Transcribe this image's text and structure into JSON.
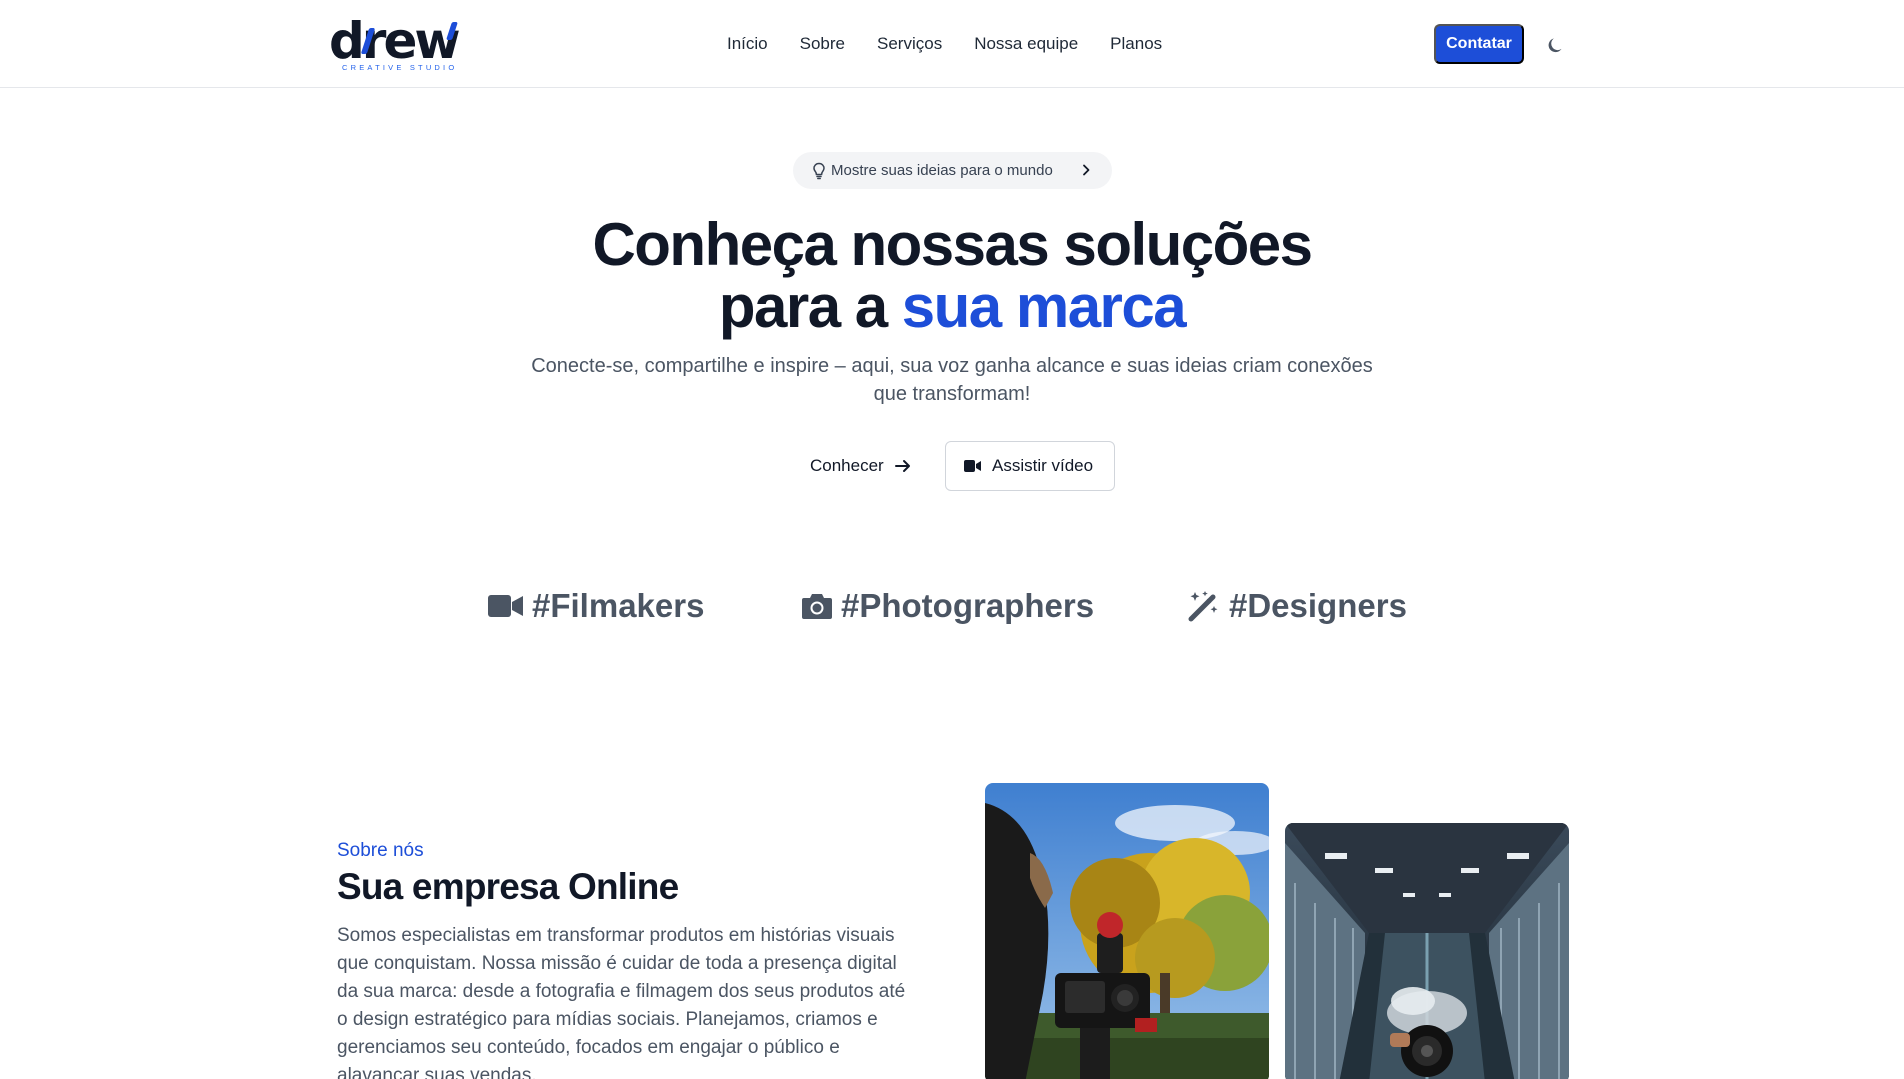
{
  "header": {
    "logo": {
      "word": "drew",
      "tagline": "CREATIVE STUDIO"
    },
    "nav": [
      "Início",
      "Sobre",
      "Serviços",
      "Nossa equipe",
      "Planos"
    ],
    "cta_label": "Contatar",
    "theme_toggle_icon": "moon-icon"
  },
  "hero": {
    "pill_text": "Mostre suas ideias para o mundo",
    "title_line1": "Conheça nossas soluções",
    "title_line2_prefix": "para a ",
    "title_line2_accent": "sua marca",
    "subtitle": "Conecte-se, compartilhe e inspire – aqui, sua voz ganha alcance e suas ideias criam conexões que transformam!",
    "primary_button": "Conhecer",
    "secondary_button": "Assistir vídeo"
  },
  "tags": [
    {
      "label": "#Filmakers",
      "icon": "video-camera-icon"
    },
    {
      "label": "#Photographers",
      "icon": "camera-icon"
    },
    {
      "label": "#Designers",
      "icon": "magic-wand-icon"
    }
  ],
  "about": {
    "kicker": "Sobre nós",
    "title": "Sua empresa Online",
    "text": "Somos especialistas em transformar produtos em histórias visuais que conquistam. Nossa missão é cuidar de toda a presença digital da sua marca: desde a fotografia e filmagem dos seus produtos até o design estratégico para mídias sociais. Planejamos, criamos e gerenciamos seu conteúdo, focados em engajar o público e alavancar suas vendas."
  },
  "colors": {
    "accent": "#1d4ed8",
    "text_dark": "#111827",
    "text_muted": "#4b5563",
    "pill_bg": "#f3f4f6",
    "border": "#e5e7eb"
  }
}
